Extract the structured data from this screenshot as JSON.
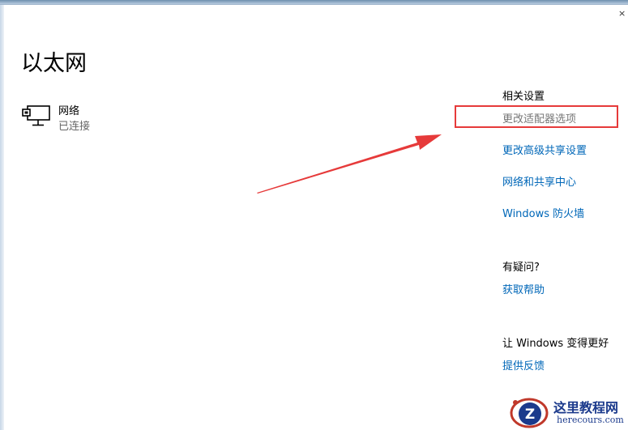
{
  "window": {
    "close_glyph": "×"
  },
  "page": {
    "title": "以太网"
  },
  "network": {
    "icon": "wired-network-monitor-icon",
    "name": "网络",
    "status": "已连接"
  },
  "related_settings": {
    "heading": "相关设置",
    "links": [
      {
        "label": "更改适配器选项",
        "highlighted": true
      },
      {
        "label": "更改高级共享设置"
      },
      {
        "label": "网络和共享中心"
      },
      {
        "label": "Windows 防火墙"
      }
    ]
  },
  "help": {
    "heading": "有疑问?",
    "link": "获取帮助"
  },
  "feedback": {
    "heading": "让 Windows 变得更好",
    "link": "提供反馈"
  },
  "annotation": {
    "arrow_color": "#e63a3a",
    "box_color": "#e63a3a"
  },
  "watermark": {
    "logo_letter": "Z",
    "site_name": "这里教程网",
    "site_url": "herecours.com"
  },
  "colors": {
    "link": "#0067b8",
    "muted_link": "#767676"
  }
}
